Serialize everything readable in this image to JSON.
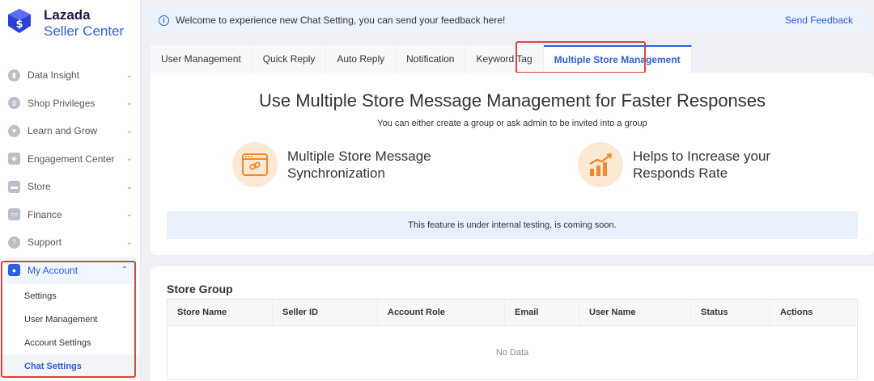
{
  "brand": {
    "line1": "Lazada",
    "line2": "Seller Center"
  },
  "sidebar": {
    "items": [
      {
        "label": "Data Insight",
        "icon": "chart-icon"
      },
      {
        "label": "Shop Privileges",
        "icon": "dollar-icon"
      },
      {
        "label": "Learn and Grow",
        "icon": "heart-icon"
      },
      {
        "label": "Engagement Center",
        "icon": "engagement-icon"
      },
      {
        "label": "Store",
        "icon": "store-icon"
      },
      {
        "label": "Finance",
        "icon": "wallet-icon"
      },
      {
        "label": "Support",
        "icon": "help-icon"
      }
    ],
    "active": {
      "label": "My Account",
      "icon": "account-icon"
    },
    "subitems": [
      "Settings",
      "User Management",
      "Account Settings",
      "Chat Settings"
    ]
  },
  "banner": {
    "text": "Welcome to experience new Chat Setting, you can send your feedback here!",
    "link": "Send Feedback"
  },
  "tabs": [
    "User Management",
    "Quick Reply",
    "Auto Reply",
    "Notification",
    "Keyword Tag",
    "Multiple Store Management"
  ],
  "main": {
    "title": "Use Multiple Store Message Management for Faster Responses",
    "subtitle": "You can either create a group or ask admin to be invited into a group",
    "feature1": {
      "line1": "Multiple Store Message",
      "line2": "Synchronization"
    },
    "feature2": {
      "line1": "Helps to Increase your",
      "line2": "Responds Rate"
    },
    "notice": "This feature is under internal testing, is coming soon."
  },
  "store_group": {
    "title": "Store Group",
    "columns": [
      "Store Name",
      "Seller ID",
      "Account Role",
      "Email",
      "User Name",
      "Status",
      "Actions"
    ],
    "empty": "No Data"
  },
  "colors": {
    "accent": "#2d5fe0",
    "highlight": "#e0443a",
    "feature_bg": "#fbe9d4",
    "feature_fg": "#f08a2c"
  }
}
